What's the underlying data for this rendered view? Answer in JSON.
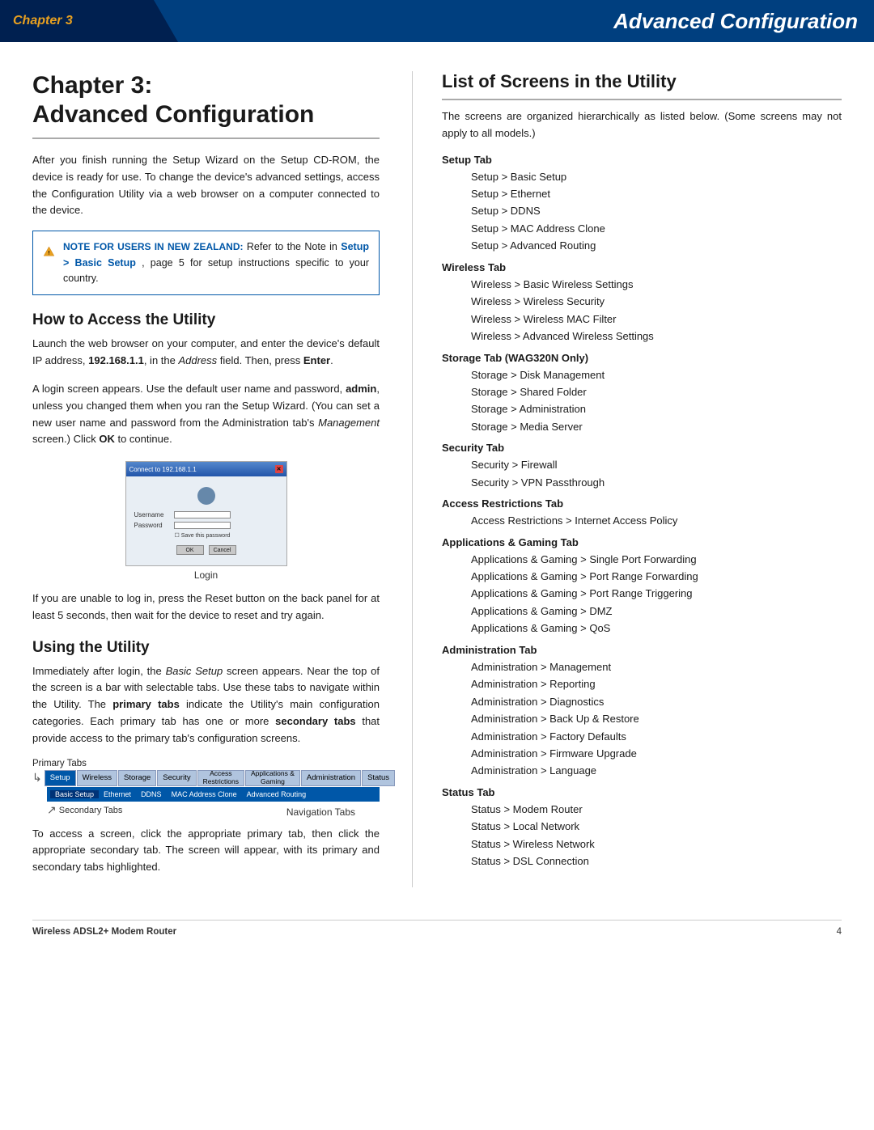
{
  "header": {
    "chapter_label": "Chapter 3",
    "title": "Advanced Configuration"
  },
  "chapter": {
    "heading_line1": "Chapter 3:",
    "heading_line2": "Advanced Configuration",
    "intro_text": "After you finish running the Setup Wizard on the Setup CD-ROM, the device is ready for use. To change the device's advanced settings, access the Configuration Utility via a web browser on a computer connected to the device.",
    "note": {
      "label": "NOTE FOR USERS IN NEW ZEALAND:",
      "text_before": " Refer to the Note in ",
      "link_text": "Setup > Basic Setup",
      "page_ref": ", page 5",
      "text_after": " for setup instructions specific to your country."
    }
  },
  "how_to_access": {
    "heading": "How to Access the Utility",
    "para1": "Launch the web browser on your computer, and enter the device's default IP address, 192.168.1.1, in the Address field. Then, press Enter.",
    "para2": "A login screen appears. Use the default user name and password, admin, unless you changed them when you ran the Setup Wizard. (You can set a new user name and password from the Administration tab's Management screen.) Click OK to continue.",
    "login_label": "Login"
  },
  "how_to_access2": {
    "para3": "If you are unable to log in, press the Reset button on the back panel for at least 5 seconds, then wait for the device to reset and try again."
  },
  "using_utility": {
    "heading": "Using the Utility",
    "para1": "Immediately after login, the Basic Setup screen appears. Near the top of the screen is a bar with selectable tabs. Use these tabs to navigate within the Utility. The primary tabs indicate the Utility's main configuration categories. Each primary tab has one or more secondary tabs that provide access to the primary tab's configuration screens.",
    "primary_tabs_label": "Primary Tabs",
    "primary_tabs": [
      "Setup",
      "Wireless",
      "Storage",
      "Security",
      "Access Restrictions",
      "Applications & Gaming",
      "Administration",
      "Status"
    ],
    "secondary_tabs_label": "Secondary Tabs",
    "secondary_tabs": [
      "Basic Setup",
      "Ethernet",
      "DDNS",
      "MAC Address Clone",
      "Advanced Routing"
    ],
    "nav_tabs_caption": "Navigation Tabs",
    "para2": "To access a screen, click the appropriate primary tab, then click the appropriate secondary tab. The screen will appear, with its primary and secondary tabs highlighted."
  },
  "list_of_screens": {
    "heading": "List of Screens in the Utility",
    "intro": "The screens are organized hierarchically as listed below. (Some screens may not apply to all models.)",
    "sections": [
      {
        "title": "Setup Tab",
        "items": [
          "Setup > Basic Setup",
          "Setup > Ethernet",
          "Setup > DDNS",
          "Setup > MAC Address Clone",
          "Setup > Advanced Routing"
        ]
      },
      {
        "title": "Wireless Tab",
        "items": [
          "Wireless > Basic Wireless Settings",
          "Wireless > Wireless Security",
          "Wireless > Wireless MAC Filter",
          "Wireless > Advanced Wireless Settings"
        ]
      },
      {
        "title": "Storage Tab (WAG320N Only)",
        "items": [
          "Storage > Disk Management",
          "Storage > Shared Folder",
          "Storage > Administration",
          "Storage > Media Server"
        ]
      },
      {
        "title": "Security Tab",
        "items": [
          "Security > Firewall",
          "Security > VPN Passthrough"
        ]
      },
      {
        "title": "Access Restrictions Tab",
        "items": [
          "Access Restrictions > Internet Access Policy"
        ]
      },
      {
        "title": "Applications & Gaming Tab",
        "items": [
          "Applications & Gaming > Single Port Forwarding",
          "Applications & Gaming > Port Range Forwarding",
          "Applications & Gaming > Port Range Triggering",
          "Applications & Gaming > DMZ",
          "Applications & Gaming > QoS"
        ]
      },
      {
        "title": "Administration Tab",
        "items": [
          "Administration > Management",
          "Administration > Reporting",
          "Administration > Diagnostics",
          "Administration > Back Up & Restore",
          "Administration > Factory Defaults",
          "Administration > Firmware Upgrade",
          "Administration > Language"
        ]
      },
      {
        "title": "Status Tab",
        "items": [
          "Status > Modem Router",
          "Status > Local Network",
          "Status > Wireless Network",
          "Status > DSL Connection"
        ]
      }
    ]
  },
  "footer": {
    "product_name": "Wireless ADSL2+ Modem Router",
    "page_number": "4"
  }
}
